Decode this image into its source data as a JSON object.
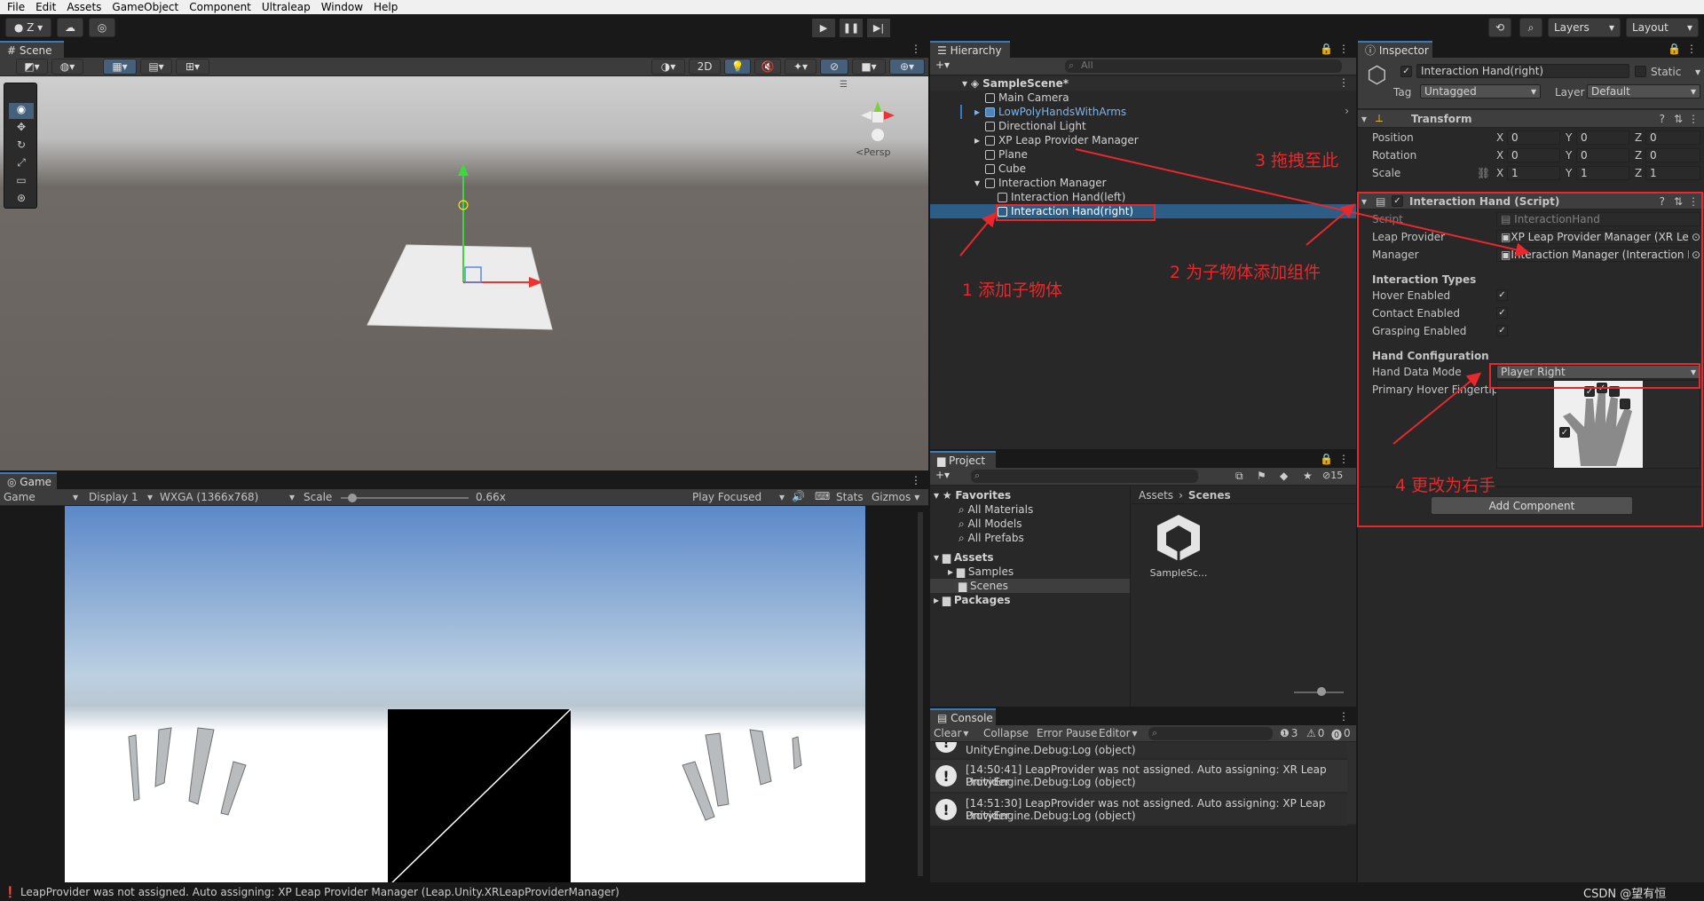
{
  "menu": [
    "File",
    "Edit",
    "Assets",
    "GameObject",
    "Component",
    "Ultraleap",
    "Window",
    "Help"
  ],
  "toolbar": {
    "account": "Z",
    "layers": "Layers",
    "layout": "Layout"
  },
  "scene": {
    "tab": "Scene",
    "btn_2d": "2D",
    "persp": "<Persp"
  },
  "game": {
    "tab": "Game",
    "mode": "Game",
    "display": "Display 1",
    "resolution": "WXGA (1366x768)",
    "scale_label": "Scale",
    "scale_value": "0.66x",
    "play_focused": "Play Focused",
    "stats": "Stats",
    "gizmos": "Gizmos"
  },
  "hierarchy": {
    "tab": "Hierarchy",
    "search_placeholder": "All",
    "scene_name": "SampleScene*",
    "items": [
      {
        "label": "Main Camera",
        "indent": 1
      },
      {
        "label": "LowPolyHandsWithArms",
        "indent": 1,
        "prefab": true
      },
      {
        "label": "Directional Light",
        "indent": 1
      },
      {
        "label": "XP Leap Provider Manager",
        "indent": 1
      },
      {
        "label": "Plane",
        "indent": 1
      },
      {
        "label": "Cube",
        "indent": 1
      },
      {
        "label": "Interaction Manager",
        "indent": 1
      },
      {
        "label": "Interaction Hand(left)",
        "indent": 2
      },
      {
        "label": "Interaction Hand(right)",
        "indent": 2,
        "selected": true
      }
    ]
  },
  "inspector": {
    "tab": "Inspector",
    "object_name": "Interaction Hand(right)",
    "static_label": "Static",
    "tag_label": "Tag",
    "tag_value": "Untagged",
    "layer_label": "Layer",
    "layer_value": "Default",
    "transform": {
      "title": "Transform",
      "position_label": "Position",
      "rotation_label": "Rotation",
      "scale_label": "Scale",
      "position": [
        "0",
        "0",
        "0"
      ],
      "rotation": [
        "0",
        "0",
        "0"
      ],
      "scale": [
        "1",
        "1",
        "1"
      ]
    },
    "component": {
      "title": "Interaction Hand (Script)",
      "script_label": "Script",
      "script_value": "InteractionHand",
      "provider_label": "Leap Provider",
      "provider_value": "XP Leap Provider Manager (XR Lea",
      "manager_label": "Manager",
      "manager_value": "Interaction Manager (Interaction M",
      "types_header": "Interaction Types",
      "hover_label": "Hover Enabled",
      "contact_label": "Contact Enabled",
      "grasp_label": "Grasping Enabled",
      "config_header": "Hand Configuration",
      "mode_label": "Hand Data Mode",
      "mode_value": "Player Right",
      "fingertip_label": "Primary Hover Fingertip"
    },
    "add_component": "Add Component"
  },
  "project": {
    "tab": "Project",
    "count": "15",
    "favorites": "Favorites",
    "fav_items": [
      "All Materials",
      "All Models",
      "All Prefabs"
    ],
    "assets": "Assets",
    "asset_items": [
      "Samples",
      "Scenes"
    ],
    "packages": "Packages",
    "breadcrumb_root": "Assets",
    "breadcrumb_current": "Scenes",
    "file_label": "SampleSc..."
  },
  "console": {
    "tab": "Console",
    "clear": "Clear",
    "collapse": "Collapse",
    "error_pause": "Error Pause",
    "editor": "Editor",
    "count_log": "3",
    "count_warn": "0",
    "count_err": "0",
    "top_line": "UnityEngine.Debug:Log (object)",
    "messages": [
      {
        "line1": "[14:50:41] LeapProvider was not assigned. Auto assigning: XR Leap Provider",
        "line2": "UnityEngine.Debug:Log (object)"
      },
      {
        "line1": "[14:51:30] LeapProvider was not assigned. Auto assigning: XP Leap Provider",
        "line2": "UnityEngine.Debug:Log (object)"
      }
    ]
  },
  "status_bar": "LeapProvider was not assigned. Auto assigning: XP Leap Provider Manager (Leap.Unity.XRLeapProviderManager)",
  "watermark": "CSDN @望有恒",
  "annotations": {
    "a1": "1 添加子物体",
    "a2": "2 为子物体添加组件",
    "a3": "3 拖拽至此",
    "a4": "4 更改为右手"
  },
  "colors": {
    "accent": "#3a79bb",
    "annotation": "#e8282c",
    "selection": "#2c5d87"
  }
}
